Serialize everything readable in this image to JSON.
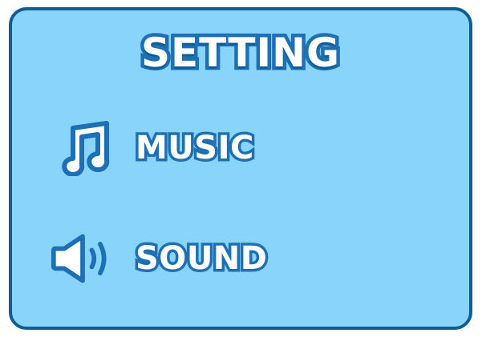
{
  "settings_panel": {
    "title": "SETTING",
    "options": [
      {
        "label": "MUSIC",
        "icon": "music-note-icon"
      },
      {
        "label": "SOUND",
        "icon": "speaker-icon"
      }
    ]
  },
  "colors": {
    "panel_fill": "#88d4fb",
    "panel_border": "#0e5d96",
    "text_fill": "#ffffff",
    "text_outline": "#1d6fb6"
  }
}
